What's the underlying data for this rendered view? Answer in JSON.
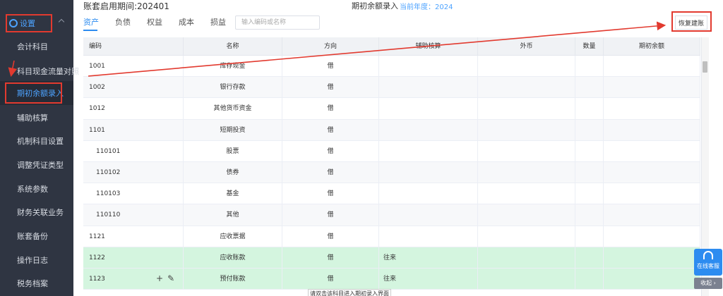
{
  "sidebar": {
    "settings_label": "设置",
    "items": [
      {
        "label": "会计科目"
      },
      {
        "label": "科目现金流量对照"
      },
      {
        "label": "期初余额录入"
      },
      {
        "label": "辅助核算"
      },
      {
        "label": "机制科目设置"
      },
      {
        "label": "调整凭证类型"
      },
      {
        "label": "系统参数"
      },
      {
        "label": "财务关联业务"
      },
      {
        "label": "账套备份"
      },
      {
        "label": "操作日志"
      },
      {
        "label": "税务档案"
      }
    ]
  },
  "header": {
    "period": "账套启用期间:202401",
    "title": "期初余额录入",
    "year": "当前年度：2024"
  },
  "tabs": [
    {
      "label": "资产"
    },
    {
      "label": "负债"
    },
    {
      "label": "权益"
    },
    {
      "label": "成本"
    },
    {
      "label": "损益"
    }
  ],
  "search": {
    "placeholder": "输入编码或名称"
  },
  "restore_button": "恢复建账",
  "table": {
    "columns": [
      "编码",
      "名称",
      "方向",
      "辅助核算",
      "外币",
      "数量",
      "期初余额"
    ],
    "rows": [
      {
        "code": "1001",
        "name": "库存现金",
        "dir": "借",
        "aux": ""
      },
      {
        "code": "1002",
        "name": "银行存款",
        "dir": "借",
        "aux": ""
      },
      {
        "code": "1012",
        "name": "其他货币资金",
        "dir": "借",
        "aux": ""
      },
      {
        "code": "1101",
        "name": "短期投资",
        "dir": "借",
        "aux": ""
      },
      {
        "code": "110101",
        "name": "股票",
        "dir": "借",
        "aux": ""
      },
      {
        "code": "110102",
        "name": "债券",
        "dir": "借",
        "aux": ""
      },
      {
        "code": "110103",
        "name": "基金",
        "dir": "借",
        "aux": ""
      },
      {
        "code": "110110",
        "name": "其他",
        "dir": "借",
        "aux": ""
      },
      {
        "code": "1121",
        "name": "应收票据",
        "dir": "借",
        "aux": ""
      },
      {
        "code": "1122",
        "name": "应收账款",
        "dir": "借",
        "aux": "往来"
      },
      {
        "code": "1123",
        "name": "预付账款",
        "dir": "借",
        "aux": "往来"
      }
    ]
  },
  "row_actions": {
    "add": "+",
    "edit": "✎"
  },
  "chat": {
    "label": "在线客服",
    "collapse": "收起 ›"
  },
  "tooltip": "请双击该科目进入期初录入界面",
  "colors": {
    "sidebar_bg": "#2f3542",
    "accent": "#2d8cf0",
    "highlight": "#e23a2f",
    "green_row": "#d4f5df"
  }
}
